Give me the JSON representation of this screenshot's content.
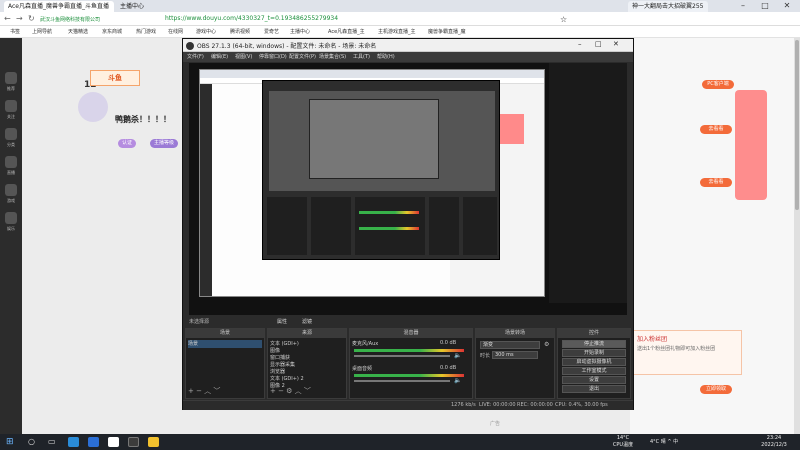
{
  "browser": {
    "tabs": [
      {
        "label": "Ace凡森直播_魔兽争霸直播_斗鱼直播",
        "active": true
      },
      {
        "label": "主播中心",
        "active": false
      }
    ],
    "right_tab": "神一大翻局击大招破翼255",
    "url": "https://www.douyu.com/4330327_t=0.193486255279934",
    "security_label": "武汉斗鱼网络科技有限公司",
    "bookmarks": [
      "书签",
      "上网导航",
      "天猫精选",
      "京东商城",
      "热门游戏",
      "在线网",
      "游戏中心",
      "腾讯视频",
      "爱奇艺",
      "主播中心",
      "Ace凡森直播_主",
      "主机游戏直播_主",
      "魔兽争霸直播_魔"
    ]
  },
  "douyu": {
    "nav": [
      {
        "label": "推荐",
        "icon": "home-icon"
      },
      {
        "label": "关注",
        "icon": "heart-icon"
      },
      {
        "label": "分类",
        "icon": "grid-icon"
      },
      {
        "label": "直播",
        "icon": "live-icon"
      },
      {
        "label": "游戏",
        "icon": "game-icon"
      },
      {
        "label": "娱乐",
        "icon": "star-icon"
      }
    ],
    "level": "12",
    "logo_text": "斗鱼",
    "room_name": "鸭鹅杀！！！！",
    "tags": [
      "认证",
      "主播等级"
    ],
    "gift_title": "加入粉丝团",
    "gift_text": "送出1个粉丝团礼物即可加入粉丝团",
    "chat_buttons": [
      "PC客户端",
      "去看看",
      "去看看",
      "立即领取"
    ],
    "scroll_hint": "广告"
  },
  "obs": {
    "title": "OBS 27.1.3 (64-bit, windows) - 配置文件: 未命名 - 场景: 未命名",
    "menu": [
      "文件(F)",
      "编辑(E)",
      "视图(V)",
      "停靠窗口(D)",
      "配置文件(P)",
      "场景集合(S)",
      "工具(T)",
      "帮助(H)"
    ],
    "preview_toolbar": [
      "未选择源",
      "属性",
      "滤镜"
    ],
    "docks": {
      "scenes": {
        "title": "场景",
        "items": [
          "场景"
        ]
      },
      "sources": {
        "title": "来源",
        "items": [
          "文本 (GDI+)",
          "图像",
          "窗口捕获",
          "显示器采集",
          "浏览器",
          "文本 (GDI+) 2",
          "图像 2"
        ]
      },
      "mixer": {
        "title": "混音器",
        "channels": [
          {
            "name": "麦克风/Aux",
            "db": "0.0 dB"
          },
          {
            "name": "桌面音频",
            "db": "0.0 dB"
          }
        ]
      },
      "transitions": {
        "title": "场景转场",
        "type": "渐变",
        "duration_label": "时长",
        "duration": "300 ms"
      },
      "controls": {
        "title": "控件",
        "buttons": [
          "停止推流",
          "开始录制",
          "启动虚拟摄像机",
          "工作室模式",
          "设置",
          "退出"
        ]
      }
    },
    "status": [
      "LIVE: 00:00:00",
      "REC: 00:00:00",
      "CPU: 0.4%, 30.00 fps",
      "1276 kb/s"
    ]
  },
  "taskbar": {
    "weather": "14°C\nCPU温度",
    "weather2": "4°C 晴 ^ 中",
    "time": "23:24",
    "date": "2022/12/3"
  },
  "colors": {
    "douyu_orange": "#f36b3a",
    "obs_bg": "#2b2b2b",
    "url_green": "#1a8f3a",
    "meter_green": "#38b24a"
  }
}
